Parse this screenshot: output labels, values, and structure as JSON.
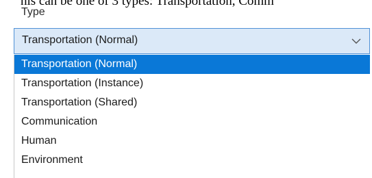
{
  "background_text": "his can be one of 3 types: Transportation, Comm",
  "field": {
    "label": "Type",
    "selected_value": "Transportation (Normal)",
    "chevron_icon": "chevron-down-icon"
  },
  "dropdown": {
    "options": [
      "Transportation (Normal)",
      "Transportation (Instance)",
      "Transportation (Shared)",
      "Communication",
      "Human",
      "Environment"
    ],
    "highlighted_option": "Transportation (Normal)"
  },
  "colors": {
    "select_bg": "#dbe9f8",
    "select_border": "#4f91d6",
    "highlight": "#0a78d7"
  }
}
